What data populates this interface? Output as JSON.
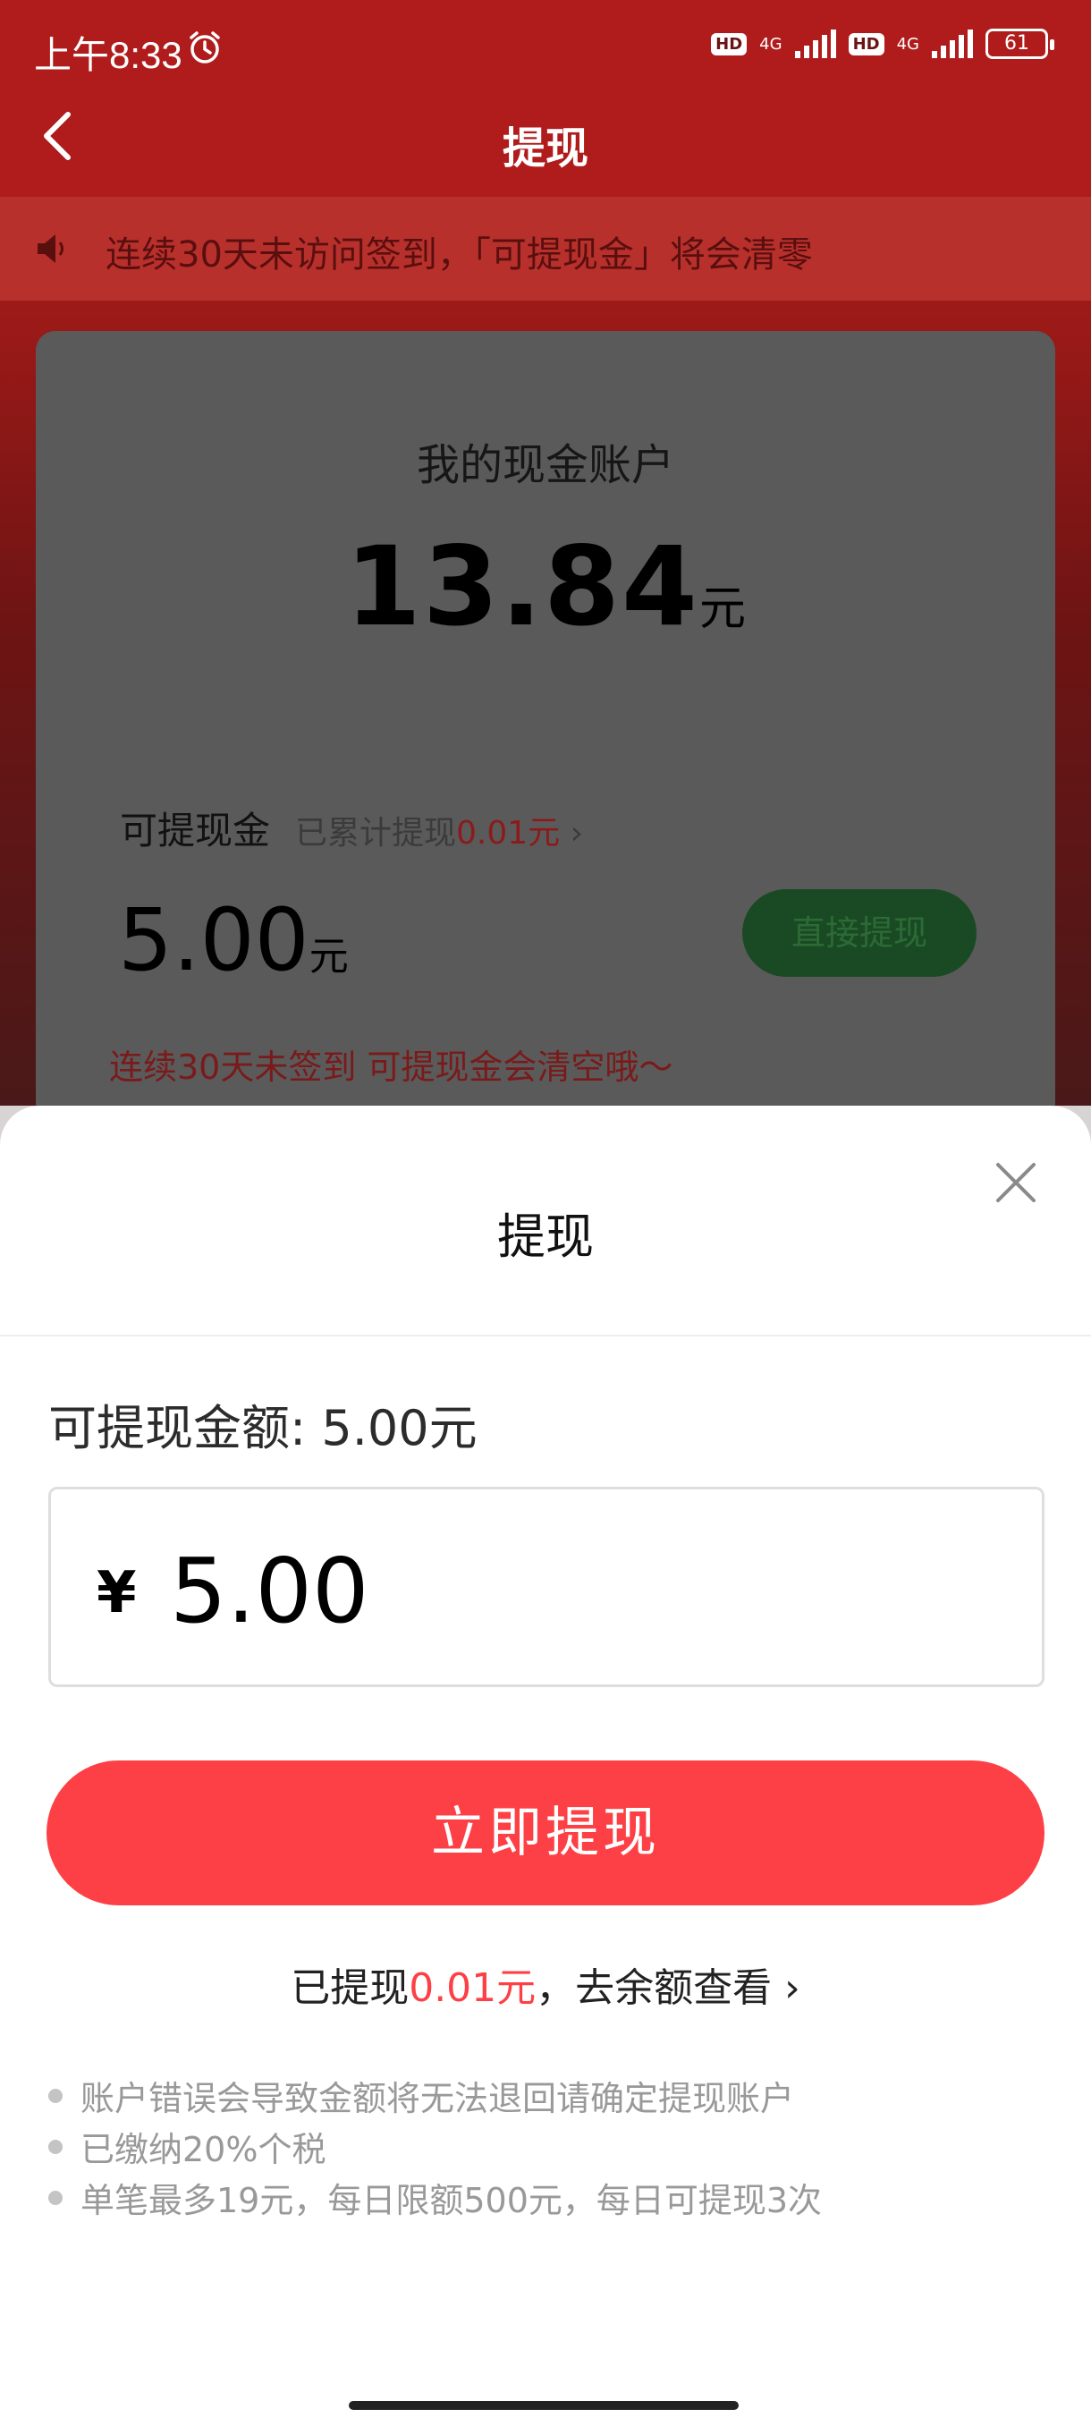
{
  "status_bar": {
    "time": "上午8:33",
    "hd1": "HD",
    "net1": "4G",
    "hd2": "HD",
    "net2": "4G",
    "battery": "61"
  },
  "nav": {
    "title": "提现"
  },
  "notice": {
    "text": "连续30天未访问签到，「可提现金」将会清零"
  },
  "account_card": {
    "title": "我的现金账户",
    "balance": "13.84",
    "balance_unit": "元",
    "withdrawable_label": "可提现金",
    "cumulative_prefix": "已累计提现",
    "cumulative_amount": "0.01元",
    "cumulative_chevron": "›",
    "withdrawable_amount": "5.00",
    "withdrawable_unit": "元",
    "direct_button": "直接提现",
    "warning": "连续30天未签到 可提现金会清空哦～"
  },
  "sheet": {
    "title": "提现",
    "available_text": "可提现金额: 5.00元",
    "currency_symbol": "¥",
    "amount_value": "5.00",
    "submit_button": "立即提现",
    "history_prefix": "已提现",
    "history_amount": "0.01元",
    "history_suffix": "，去余额查看",
    "history_chevron": "›",
    "notes": [
      "账户错误会导致金额将无法退回请确定提现账户",
      "已缴纳20%个税",
      "单笔最多19元，每日限额500元，每日可提现3次"
    ]
  },
  "colors": {
    "primary_red": "#fd4045",
    "header_red": "#b01b1b",
    "green_button": "#1a4a24"
  }
}
